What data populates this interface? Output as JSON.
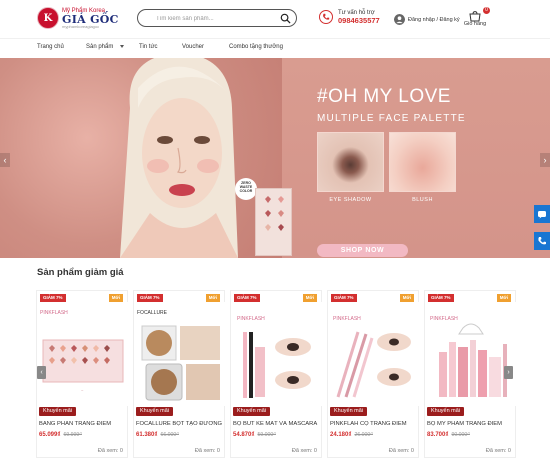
{
  "header": {
    "logo_mark": "K",
    "logo_sub": "Mỹ Phẩm Korea",
    "logo_main": "GIÁ GỐC",
    "logo_tag": "myphamkoreagiagoc",
    "search_placeholder": "Tìm kiếm sản phẩm...",
    "support_label": "Tư vấn hỗ trợ",
    "support_phone": "0984635577",
    "account_label": "Đăng nhập / Đăng ký",
    "cart_label": "Giỏ hàng",
    "cart_count": "0"
  },
  "nav": {
    "items": [
      {
        "label": "Trang chủ"
      },
      {
        "label": "Sản phẩm"
      },
      {
        "label": "Tin tức"
      },
      {
        "label": "Voucher"
      },
      {
        "label": "Combo tặng thưởng"
      }
    ]
  },
  "banner": {
    "headline": "#OH MY LOVE",
    "subline": "MULTIPLE FACE PALETTE",
    "swatch_left": "EYE SHADOW",
    "swatch_right": "BLUSH",
    "button": "SHOP NOW",
    "sticker": "ZERO WASTE COLOR",
    "prev": "‹",
    "next": "›"
  },
  "section": {
    "title": "Sản phẩm giảm giá"
  },
  "products": [
    {
      "brand": "PINKFLASH",
      "discount": "GIẢM 7%",
      "badge": "Mới",
      "promo": "Khuyến mãi",
      "name": "BẢNG PHẤN TRANG ĐIỂM",
      "price": "65.099₫",
      "old_price": "69.999₫",
      "sold": "Đã xem: 0"
    },
    {
      "brand": "FOCALLURE",
      "discount": "GIẢM 7%",
      "badge": "Mới",
      "promo": "Khuyến mãi",
      "name": "FOCALLURE BỘT TẠO ĐƯỜNG",
      "price": "61.380₫",
      "old_price": "66.000₫",
      "sold": "Đã xem: 0"
    },
    {
      "brand": "PINKFLASH",
      "discount": "GIẢM 7%",
      "badge": "Mới",
      "promo": "Khuyến mãi",
      "name": "BỘ BÚT KẺ MẮT VÀ MASCARA",
      "price": "54.870₫",
      "old_price": "59.000₫",
      "sold": "Đã xem: 0"
    },
    {
      "brand": "PINKFLASH",
      "discount": "GIẢM 7%",
      "badge": "Mới",
      "promo": "Khuyến mãi",
      "name": "PINKFLAH CỌ TRANG ĐIỂM",
      "price": "24.180₫",
      "old_price": "26.000₫",
      "sold": "Đã xem: 0"
    },
    {
      "brand": "PINKFLASH",
      "discount": "GIẢM 7%",
      "badge": "Mới",
      "promo": "Khuyến mãi",
      "name": "BỘ MỸ PHẨM TRANG ĐIỂM",
      "price": "83.700₫",
      "old_price": "90.000₫",
      "sold": "Đã xem: 0"
    }
  ],
  "colors": {
    "accent": "#d32f2f",
    "brand_navy": "#1f2d7a",
    "banner_pink": "#d89a8e",
    "badge_orange": "#f0a030",
    "promo_red": "#9b1d1d",
    "side_blue": "#1976d2"
  },
  "icons": [
    "search-icon",
    "phone-icon",
    "user-icon",
    "cart-icon",
    "chevron-left-icon",
    "chevron-right-icon",
    "zalo-icon",
    "call-icon"
  ]
}
